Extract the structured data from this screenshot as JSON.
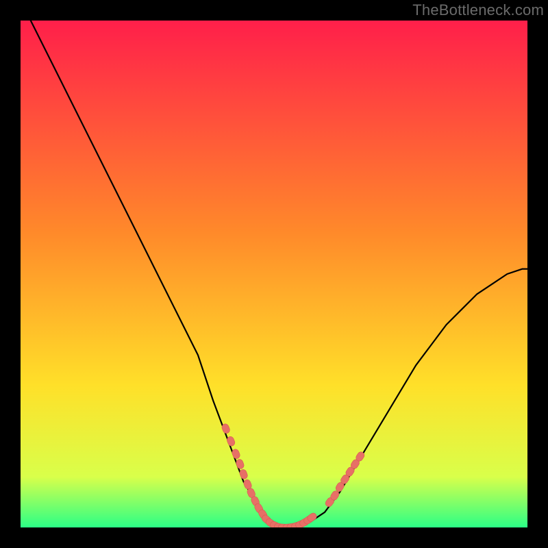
{
  "watermark": "TheBottleneck.com",
  "colors": {
    "gradient_top": "#ff1f4a",
    "gradient_mid1": "#ff8a2a",
    "gradient_mid2": "#ffe029",
    "gradient_bottom": "#2bff86",
    "curve": "#000000",
    "marker_fill": "#e77066",
    "marker_stroke": "#d85a50"
  },
  "chart_data": {
    "type": "line",
    "title": "",
    "xlabel": "",
    "ylabel": "",
    "xlim": [
      0,
      100
    ],
    "ylim": [
      0,
      100
    ],
    "grid": false,
    "series": [
      {
        "name": "curve",
        "x": [
          2,
          5,
          8,
          11,
          14,
          17,
          20,
          23,
          26,
          29,
          32,
          35,
          38,
          41,
          44,
          47,
          49,
          51,
          53,
          55,
          57,
          60,
          63,
          66,
          69,
          72,
          75,
          78,
          81,
          84,
          87,
          90,
          93,
          96,
          99,
          100
        ],
        "y": [
          100,
          94,
          88,
          82,
          76,
          70,
          64,
          58,
          52,
          46,
          40,
          34,
          25,
          17,
          9,
          4,
          1,
          0,
          0,
          0,
          1,
          3,
          7,
          12,
          17,
          22,
          27,
          32,
          36,
          40,
          43,
          46,
          48,
          50,
          51,
          51
        ]
      }
    ],
    "markers": [
      {
        "name": "left-cluster",
        "points": [
          {
            "x": 40.5,
            "y": 19.5
          },
          {
            "x": 41.5,
            "y": 17.0
          },
          {
            "x": 42.5,
            "y": 14.5
          },
          {
            "x": 43.3,
            "y": 12.5
          },
          {
            "x": 44.0,
            "y": 10.5
          },
          {
            "x": 44.8,
            "y": 8.5
          },
          {
            "x": 45.5,
            "y": 6.8
          },
          {
            "x": 46.3,
            "y": 5.2
          },
          {
            "x": 47.0,
            "y": 3.8
          },
          {
            "x": 47.8,
            "y": 2.6
          }
        ]
      },
      {
        "name": "bottom-cluster",
        "points": [
          {
            "x": 48.5,
            "y": 1.6
          },
          {
            "x": 49.3,
            "y": 0.9
          },
          {
            "x": 50.2,
            "y": 0.4
          },
          {
            "x": 51.0,
            "y": 0.1
          },
          {
            "x": 51.8,
            "y": 0.0
          },
          {
            "x": 52.7,
            "y": 0.0
          },
          {
            "x": 53.5,
            "y": 0.1
          },
          {
            "x": 54.4,
            "y": 0.3
          },
          {
            "x": 55.2,
            "y": 0.6
          },
          {
            "x": 56.0,
            "y": 1.0
          },
          {
            "x": 56.8,
            "y": 1.5
          },
          {
            "x": 57.5,
            "y": 2.0
          }
        ]
      },
      {
        "name": "right-cluster",
        "points": [
          {
            "x": 61.0,
            "y": 5.0
          },
          {
            "x": 62.0,
            "y": 6.3
          },
          {
            "x": 63.0,
            "y": 8.0
          },
          {
            "x": 64.0,
            "y": 9.5
          },
          {
            "x": 65.0,
            "y": 11.0
          },
          {
            "x": 66.0,
            "y": 12.5
          },
          {
            "x": 67.0,
            "y": 14.0
          }
        ]
      }
    ]
  }
}
